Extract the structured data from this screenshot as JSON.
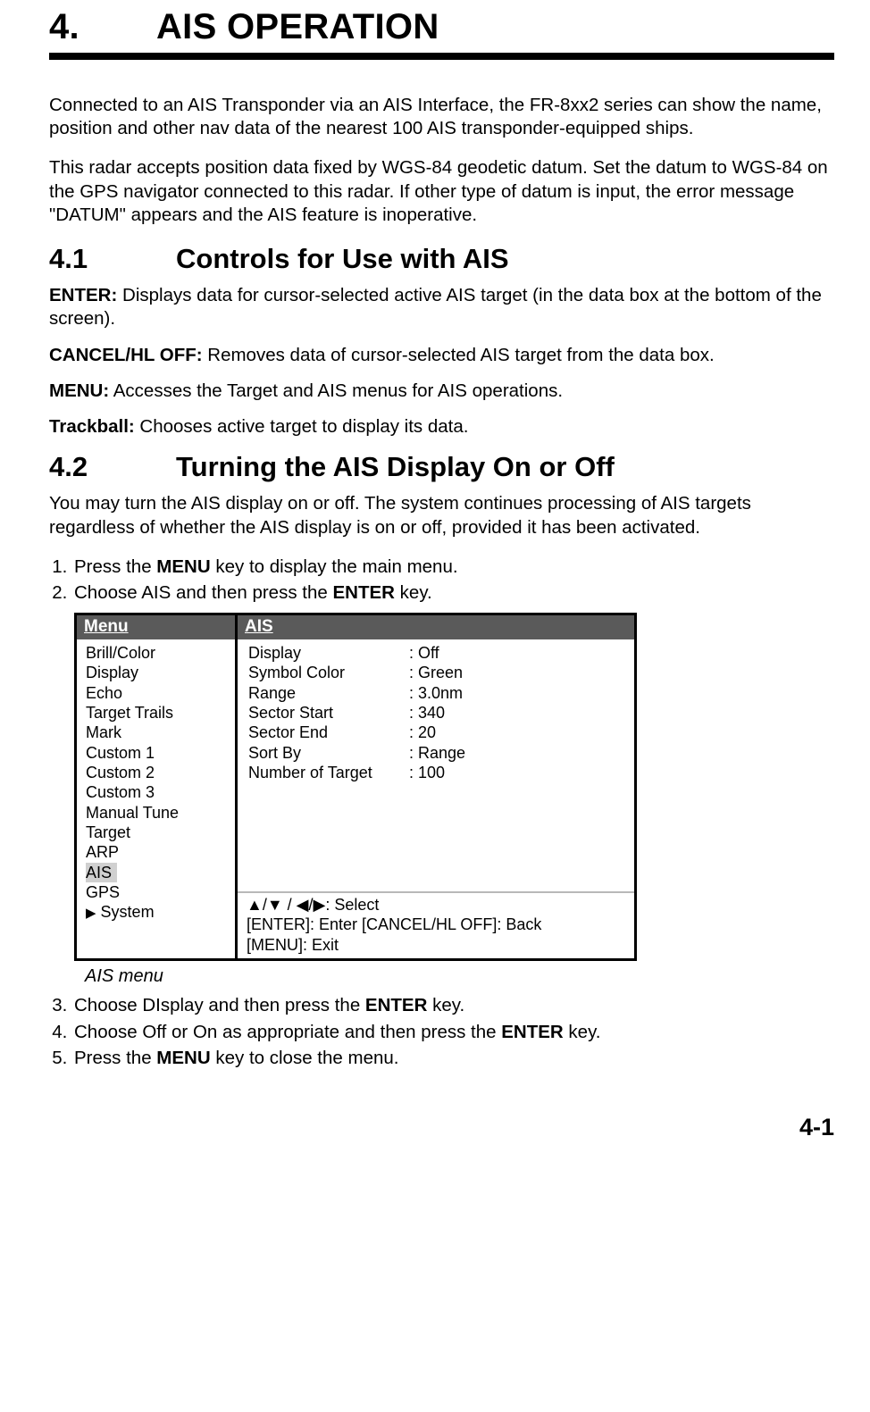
{
  "chapter": {
    "number": "4.",
    "title": "AIS OPERATION"
  },
  "intro": {
    "p1": "Connected to an AIS Transponder via an AIS Interface, the FR-8xx2 series can show the name, position and other nav data of the nearest 100 AIS transponder-equipped ships.",
    "p2": "This radar accepts position data fixed by WGS-84 geodetic datum. Set the datum to WGS-84 on the GPS navigator connected to this radar. If other type of datum is input, the error message \"DATUM\" appears and the AIS feature is inoperative."
  },
  "section1": {
    "number": "4.1",
    "title": "Controls for Use with AIS",
    "controls": {
      "enter_label": "ENTER:",
      "enter_desc": " Displays data for cursor-selected active AIS target (in the data box at the bottom of the screen).",
      "cancel_label": "CANCEL/HL OFF:",
      "cancel_desc": " Removes data of cursor-selected AIS target from the data box.",
      "menu_label": "MENU:",
      "menu_desc": " Accesses the Target and AIS menus for AIS operations.",
      "trackball_label": "Trackball:",
      "trackball_desc": " Chooses active target to display its data."
    }
  },
  "section2": {
    "number": "4.2",
    "title": "Turning the AIS Display On or Off",
    "p1": "You may turn the AIS display on or off. The system continues processing of AIS targets regardless of whether the AIS display is on or off, provided it has been activated.",
    "steps": {
      "s1a": "Press the ",
      "s1b": "MENU",
      "s1c": " key to display the main menu.",
      "s2a": "Choose AIS and then press the ",
      "s2b": "ENTER",
      "s2c": " key.",
      "s3a": "Choose DIsplay and then press the ",
      "s3b": "ENTER",
      "s3c": " key.",
      "s4a": "Choose Off or On as appropriate and then press the ",
      "s4b": "ENTER",
      "s4c": " key.",
      "s5a": "Press the ",
      "s5b": "MENU",
      "s5c": " key to close the menu."
    }
  },
  "menu_figure": {
    "left_header": "Menu",
    "right_header": "AIS",
    "left_items": {
      "i0": "Brill/Color",
      "i1": "Display",
      "i2": "Echo",
      "i3": "Target Trails",
      "i4": "Mark",
      "i5": "Custom 1",
      "i6": "Custom 2",
      "i7": "Custom 3",
      "i8": "Manual Tune",
      "i9": "Target",
      "i10": "ARP",
      "i11": "AIS",
      "i12": "GPS",
      "i13_arrow": "▶",
      "i13": " System"
    },
    "right_rows": {
      "k0": "Display",
      "v0": ": Off",
      "k1": "Symbol Color",
      "v1": ": Green",
      "k2": "Range",
      "v2": ": 3.0nm",
      "k3": "Sector Start",
      "v3": ": 340",
      "k4": "Sector End",
      "v4": ": 20",
      "k5": "Sort By",
      "v5": ": Range",
      "k6": "Number of Target",
      "v6": ": 100"
    },
    "footer": {
      "line1": "▲/▼ / ◀/▶: Select",
      "line2": "[ENTER]: Enter  [CANCEL/HL OFF]: Back",
      "line3": "[MENU]: Exit"
    },
    "caption": "AIS menu"
  },
  "page_number": "4-1"
}
